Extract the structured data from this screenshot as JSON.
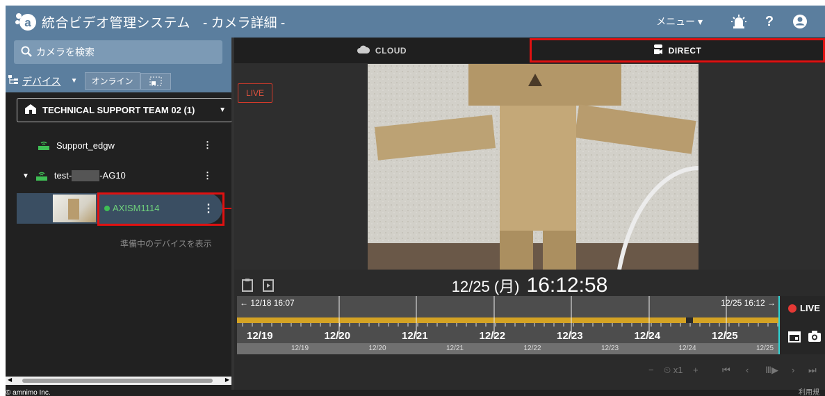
{
  "header": {
    "app_title": "統合ビデオ管理システム",
    "page_subtitle": "- カメラ詳細 -",
    "menu_label": "メニュー"
  },
  "sidebar": {
    "search_placeholder": "カメラを検索",
    "device_selector": "デバイス",
    "online_label": "オンライン",
    "team_name": "TECHNICAL SUPPORT TEAM 02 (1)",
    "nodes": [
      {
        "label": "Support_edgw"
      },
      {
        "label_prefix": "test-",
        "label_suffix": "-AG10"
      }
    ],
    "camera": {
      "name": "AXISM1114",
      "status_color": "#3fbf55"
    },
    "show_preparing": "準備中のデバイスを表示"
  },
  "footer": {
    "copyright": "© amnimo Inc.",
    "terms": "利用規"
  },
  "main": {
    "tabs": [
      {
        "label": "CLOUD"
      },
      {
        "label": "DIRECT"
      }
    ],
    "live_badge": "LIVE",
    "date": "12/25 (月)",
    "time": "16:12:58",
    "timeline": {
      "range_start": "← 12/18 16:07",
      "range_end": "12/25 16:12 →",
      "days": [
        "12/19",
        "12/20",
        "12/21",
        "12/22",
        "12/23",
        "12/24",
        "12/25"
      ],
      "live_label": "LIVE",
      "speed": "x1"
    }
  },
  "colors": {
    "header": "#5b7e9e",
    "accent": "#d4a324",
    "highlight": "#e01111",
    "online": "#3fbf55"
  }
}
